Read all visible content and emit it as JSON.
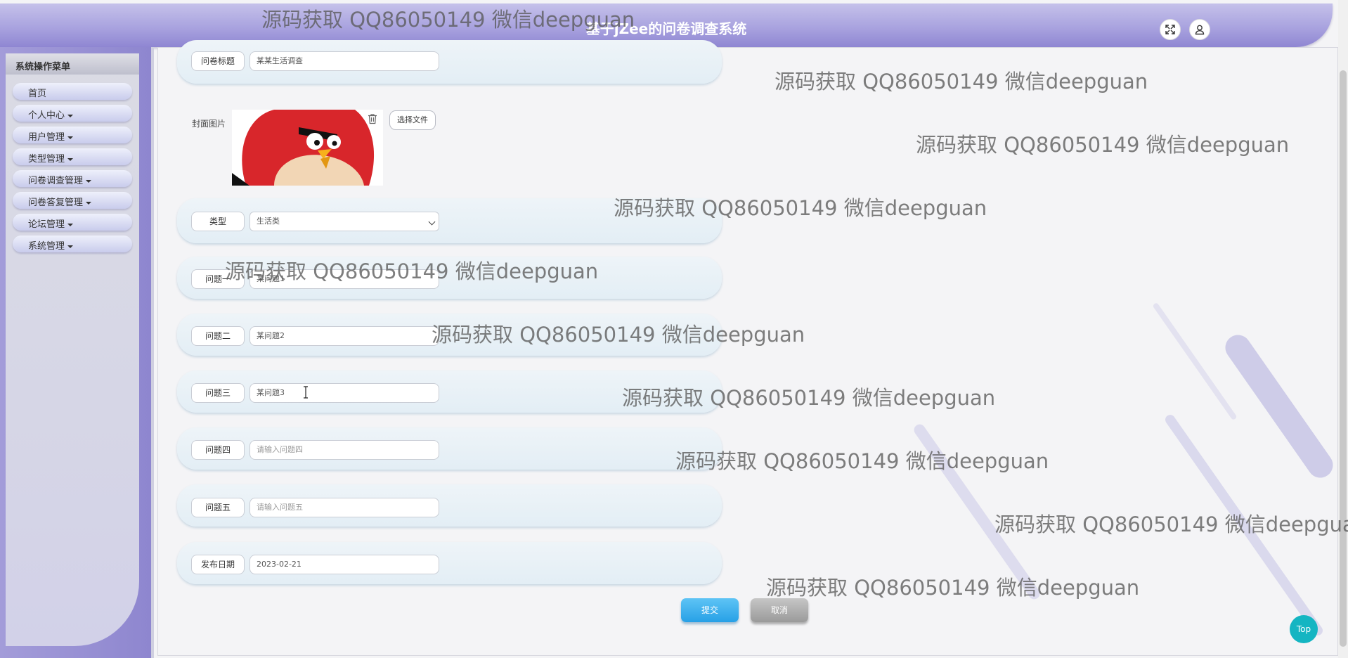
{
  "header": {
    "title": "基于jZee的问卷调查系统"
  },
  "sidebar": {
    "title": "系统操作菜单",
    "items": [
      {
        "label": "首页",
        "dropdown": false
      },
      {
        "label": "个人中心",
        "dropdown": true
      },
      {
        "label": "用户管理",
        "dropdown": true
      },
      {
        "label": "类型管理",
        "dropdown": true
      },
      {
        "label": "问卷调查管理",
        "dropdown": true
      },
      {
        "label": "问卷答复管理",
        "dropdown": true
      },
      {
        "label": "论坛管理",
        "dropdown": true
      },
      {
        "label": "系统管理",
        "dropdown": true
      }
    ]
  },
  "form": {
    "title_label": "问卷标题",
    "title_value": "某某生活调查",
    "cover_label": "封面图片",
    "file_button": "选择文件",
    "type_label": "类型",
    "type_value": "生活类",
    "q1_label": "问题一",
    "q1_value": "某问题1",
    "q2_label": "问题二",
    "q2_value": "某问题2",
    "q3_label": "问题三",
    "q3_value": "某问题3",
    "q4_label": "问题四",
    "q4_placeholder": "请输入问题四",
    "q5_label": "问题五",
    "q5_placeholder": "请输入问题五",
    "date_label": "发布日期",
    "date_value": "2023-02-21",
    "submit": "提交",
    "cancel": "取消"
  },
  "top_button": "Top",
  "watermark": "源码获取 QQ86050149 微信deepguan",
  "icons": {
    "fullscreen": "expand-icon",
    "user": "user-icon",
    "delete": "trash-icon"
  }
}
